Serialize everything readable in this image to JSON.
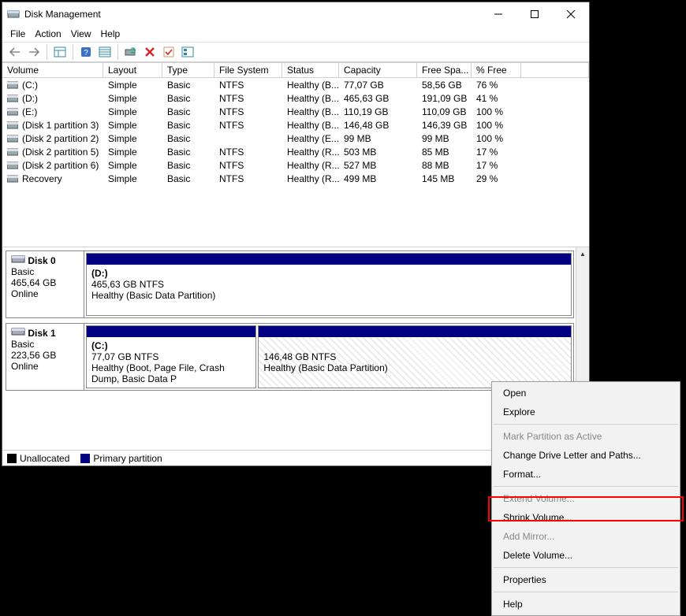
{
  "window": {
    "title": "Disk Management"
  },
  "menu": {
    "file": "File",
    "action": "Action",
    "view": "View",
    "help": "Help"
  },
  "columns": {
    "vol": "Volume",
    "lay": "Layout",
    "type": "Type",
    "fs": "File System",
    "stat": "Status",
    "cap": "Capacity",
    "free": "Free Spa...",
    "pct": "% Free"
  },
  "rows": [
    {
      "vol": "(C:)",
      "lay": "Simple",
      "type": "Basic",
      "fs": "NTFS",
      "stat": "Healthy (B...",
      "cap": "77,07 GB",
      "free": "58,56 GB",
      "pct": "76 %"
    },
    {
      "vol": "(D:)",
      "lay": "Simple",
      "type": "Basic",
      "fs": "NTFS",
      "stat": "Healthy (B...",
      "cap": "465,63 GB",
      "free": "191,09 GB",
      "pct": "41 %"
    },
    {
      "vol": "(E:)",
      "lay": "Simple",
      "type": "Basic",
      "fs": "NTFS",
      "stat": "Healthy (B...",
      "cap": "110,19 GB",
      "free": "110,09 GB",
      "pct": "100 %"
    },
    {
      "vol": "(Disk 1 partition 3)",
      "lay": "Simple",
      "type": "Basic",
      "fs": "NTFS",
      "stat": "Healthy (B...",
      "cap": "146,48 GB",
      "free": "146,39 GB",
      "pct": "100 %"
    },
    {
      "vol": "(Disk 2 partition 2)",
      "lay": "Simple",
      "type": "Basic",
      "fs": "",
      "stat": "Healthy (E...",
      "cap": "99 MB",
      "free": "99 MB",
      "pct": "100 %"
    },
    {
      "vol": "(Disk 2 partition 5)",
      "lay": "Simple",
      "type": "Basic",
      "fs": "NTFS",
      "stat": "Healthy (R...",
      "cap": "503 MB",
      "free": "85 MB",
      "pct": "17 %"
    },
    {
      "vol": "(Disk 2 partition 6)",
      "lay": "Simple",
      "type": "Basic",
      "fs": "NTFS",
      "stat": "Healthy (R...",
      "cap": "527 MB",
      "free": "88 MB",
      "pct": "17 %"
    },
    {
      "vol": "Recovery",
      "lay": "Simple",
      "type": "Basic",
      "fs": "NTFS",
      "stat": "Healthy (R...",
      "cap": "499 MB",
      "free": "145 MB",
      "pct": "29 %"
    }
  ],
  "disk0": {
    "name": "Disk 0",
    "type": "Basic",
    "size": "465,64 GB",
    "status": "Online",
    "p0": {
      "label": "(D:)",
      "line2": "465,63 GB NTFS",
      "line3": "Healthy (Basic Data Partition)"
    }
  },
  "disk1": {
    "name": "Disk 1",
    "type": "Basic",
    "size": "223,56 GB",
    "status": "Online",
    "p0": {
      "label": "(C:)",
      "line2": "77,07 GB NTFS",
      "line3": "Healthy (Boot, Page File, Crash Dump, Basic Data P"
    },
    "p1": {
      "label": "",
      "line2": "146,48 GB NTFS",
      "line3": "Healthy (Basic Data Partition)"
    }
  },
  "legend": {
    "unalloc": "Unallocated",
    "primary": "Primary partition"
  },
  "ctx": {
    "open": "Open",
    "explore": "Explore",
    "mark": "Mark Partition as Active",
    "change": "Change Drive Letter and Paths...",
    "format": "Format...",
    "extend": "Extend Volume...",
    "shrink": "Shrink Volume...",
    "mirror": "Add Mirror...",
    "del": "Delete Volume...",
    "props": "Properties",
    "help": "Help"
  }
}
